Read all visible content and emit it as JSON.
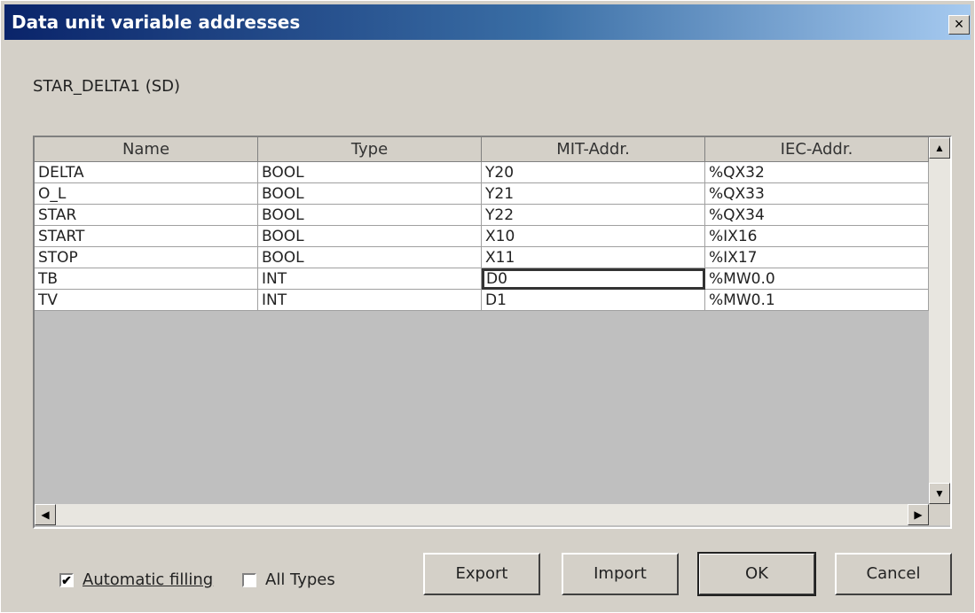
{
  "window": {
    "title": "Data unit variable addresses",
    "close_glyph": "×"
  },
  "unit_label": "STAR_DELTA1 (SD)",
  "table": {
    "columns": [
      "Name",
      "Type",
      "MIT-Addr.",
      "IEC-Addr."
    ],
    "rows": [
      [
        "DELTA",
        "BOOL",
        "Y20",
        "%QX32"
      ],
      [
        "O_L",
        "BOOL",
        "Y21",
        "%QX33"
      ],
      [
        "STAR",
        "BOOL",
        "Y22",
        "%QX34"
      ],
      [
        "START",
        "BOOL",
        "X10",
        "%IX16"
      ],
      [
        "STOP",
        "BOOL",
        "X11",
        "%IX17"
      ],
      [
        "TB",
        "INT",
        "D0",
        "%MW0.0"
      ],
      [
        "TV",
        "INT",
        "D1",
        "%MW0.1"
      ]
    ],
    "selected_cell": {
      "row": 5,
      "column": 2
    }
  },
  "scrollbars": {
    "up": "▲",
    "down": "▼",
    "left": "◀",
    "right": "▶"
  },
  "options": {
    "automatic_filling": {
      "label": "Automatic filling",
      "checked": true,
      "mark": "✔"
    },
    "all_types": {
      "label": "All Types",
      "checked": false,
      "mark": ""
    }
  },
  "buttons": {
    "export": "Export",
    "import": "Import",
    "ok": "OK",
    "cancel": "Cancel"
  }
}
